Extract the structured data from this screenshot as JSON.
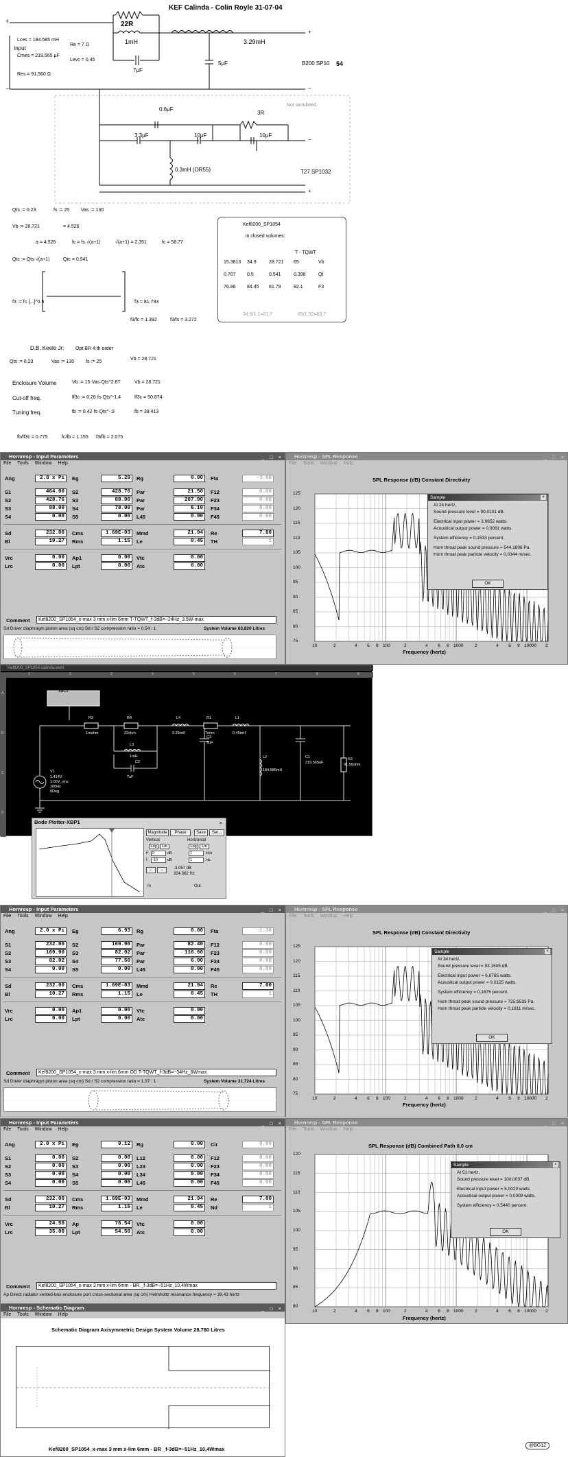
{
  "sketch": {
    "title": "KEF Calinda - Colin Royle 31-07-04",
    "lces": "Lces = 184.585 mH",
    "input": "Input",
    "cmes": "Cmes = 219.565 μF",
    "res": "Res = 91.560 Ω",
    "re": "Re = 7 Ω",
    "levc": "Levc = 0.45",
    "r22": "22R",
    "l1": "1mH",
    "c7": "7μF",
    "l329": "3.29mH",
    "c5": "5μF",
    "b200": "B200 SP10",
    "b200_num": "54",
    "notsim": "Not simulated.",
    "c06": "0.6μF",
    "r3": "3R",
    "c33": "3.3μF",
    "c10a": "10μF",
    "c10b": "10μF",
    "l03": "0.3mH (OR55)",
    "t27": "T27 SP1032",
    "plus": "+",
    "minus": "−",
    "l_qts": "Qts := 0.23",
    "l_fs": "fs := 25",
    "l_vas": "Vas := 130",
    "l_vb": "Vb := 28.721",
    "l_vb_res": "= 4.526",
    "l_a_res": "a = 4.526",
    "l_fc": "fc = fs·√(a+1)",
    "l_fc2": "√(a+1) = 2.351",
    "l_fc3": "fc = 58.77",
    "l_qtc": "Qtc := Qts·√(a+1)",
    "l_qtc2": "Qtc = 0.541",
    "l_f3": "f3 := fc·[...]^0.5",
    "l_f3r": "f3 = 81.793",
    "l_r1": "f3/fc = 1.392",
    "l_r2": "f3/fs = 3.272",
    "dbk": "D.B. Keele Jr:",
    "opt": "Opt BR 4:th order",
    "l2_qts": "Qts := 0.23",
    "l2_vas": "Vas := 130",
    "l2_fs": "fs := 25",
    "l2_vb": "Vb = 28.721",
    "ev": "Enclosure Volume",
    "ev_f": "Vb := 15·Vas·Qts^2.87",
    "ev_r": "Vb = 28.721",
    "cf": "Cut-off freq.",
    "cf_f": "ff3c := 0.26·fs·Qts^-1.4",
    "cf_r": "ff3c = 50.874",
    "tf": "Tuning freq.",
    "tf_f": "fb := 0.42·fs·Qts^-.9",
    "tf_r": "fb = 39.413",
    "last1": "fb/ff3c = 0.775",
    "last2": "fc/fb = 1.155",
    "last3": "f3/fb = 2.075",
    "box_title": "Kef8200_SP1054",
    "box_sub": "in closed volumes:",
    "box_ttq": "T - TQWT",
    "box_rows": [
      [
        "15.3813",
        "34.9",
        "28.721",
        "65",
        "Vb"
      ],
      [
        "0.707",
        "0.5",
        "0.541",
        "0.398",
        "Qt"
      ],
      [
        "76.86",
        "84.45",
        "81.79",
        "92.1",
        "F3"
      ]
    ],
    "box_n1": "34.9/1.1=31.7",
    "box_n2": "65/1.02=63.7"
  },
  "w1": {
    "title": "Hornresp - Input Parameters",
    "menu": [
      "File",
      "Tools",
      "Window",
      "Help"
    ],
    "rows": [
      [
        [
          "Ang",
          "2.0 x Pi"
        ],
        [
          "Eg",
          "5.29"
        ],
        [
          "Rg",
          "0.00"
        ],
        [
          "Fta",
          "-3.00"
        ]
      ],
      [
        [
          "S1",
          "464.00"
        ],
        [
          "S2",
          "428.76"
        ],
        [
          "Par",
          "21.50"
        ],
        [
          "F12",
          "0.00"
        ]
      ],
      [
        [
          "S2",
          "428.76"
        ],
        [
          "S3",
          "88.00"
        ],
        [
          "Par",
          "207.90"
        ],
        [
          "F23",
          "0.00"
        ]
      ],
      [
        [
          "S3",
          "88.00"
        ],
        [
          "S4",
          "78.00"
        ],
        [
          "Par",
          "6.10"
        ],
        [
          "F34",
          "0.00"
        ]
      ],
      [
        [
          "S4",
          "0.00"
        ],
        [
          "S5",
          "0.00"
        ],
        [
          "L45",
          "0.00"
        ],
        [
          "F45",
          "0.00"
        ]
      ],
      [
        [
          "Sd",
          "232.00"
        ],
        [
          "Cms",
          "1.69E-03"
        ],
        [
          "Mmd",
          "21.94"
        ],
        [
          "Re",
          "7.00"
        ]
      ],
      [
        [
          "Bl",
          "10.27"
        ],
        [
          "Rms",
          "1.15"
        ],
        [
          "Le",
          "0.45"
        ],
        [
          "TH",
          "1"
        ]
      ],
      [
        [
          "Vrc",
          "0.00"
        ],
        [
          "Ap1",
          "0.00"
        ],
        [
          "Vtc",
          "0.00"
        ],
        [
          "",
          ""
        ]
      ],
      [
        [
          "Lrc",
          "0.00"
        ],
        [
          "Lpt",
          "0.00"
        ],
        [
          "Atc",
          "0.00"
        ],
        [
          "",
          ""
        ]
      ]
    ],
    "comment_label": "Comment",
    "comment": "Kef8200_SP1054_x-max 3 mm x-lim 6mm T-TQWT_f-3dB=~24Hz_3.5W-max",
    "status_l": "Sd  Driver diaphragm piston area (sq cm)   Sd / S2 compression ratio = 0.54 : 1",
    "status_r": "System Volume 63,820 Litres"
  },
  "spl1": {
    "title": "Hornresp - SPL Response",
    "menu": [
      "File",
      "Tools",
      "Window",
      "Help"
    ],
    "header": "SPL Response (dB)   Constant Directivity",
    "xlabel": "Frequency (hertz)",
    "yticks": [
      "125",
      "120",
      "115",
      "110",
      "105",
      "100",
      "95",
      "90",
      "85",
      "80",
      "75"
    ],
    "xticks": [
      "10",
      "2",
      "4",
      "6",
      "8",
      "100",
      "2",
      "4",
      "6",
      "8",
      "1000",
      "2",
      "4",
      "6",
      "8",
      "10000",
      "2"
    ],
    "dlg_title": "Sample",
    "dlg_lines": [
      "At 24 hertz,",
      "Sound pressure level = 90,0101 dB.",
      "Electrical input power = 3,9652 watts.",
      "Acoustical output power = 0,0061 watts.",
      "System efficiency = 0,1533 percent.",
      "Horn throat peak sound pressure = 544,1806 Pa.",
      "Horn throat peak particle velocity = 0,0344 m/sec."
    ],
    "ok": "OK"
  },
  "schem": {
    "title": "Kef8200_SP1054-calinda.ewm",
    "xsc": "XSC1",
    "r3": "R3",
    "r3v": "1mohm",
    "r4": "R4",
    "r4v": "22ohm",
    "l4": "L4",
    "l4v": "3.29mH",
    "r1": "R1",
    "r1v": "7ohm",
    "l1": "L1",
    "l1v": "0.45mH",
    "l3": "L3",
    "l3v": "1mH",
    "c2": "C2",
    "c2v": "7uF",
    "c3": "C3",
    "c3v": "5uF",
    "l2": "L2",
    "l2v": "184.585mH",
    "c1": "C1",
    "c1v": "219.565uF",
    "r2": "R2",
    "r2v": "91.56ohm",
    "v1": "V1",
    "v1v": "1.414V",
    "v1b": "1.00V_rms",
    "v1c": "100Hz",
    "v1d": "0Deg",
    "cols": [
      "1",
      "2",
      "3",
      "4",
      "5",
      "6",
      "7",
      "8",
      "9"
    ],
    "rows": [
      "A",
      "B",
      "C",
      "D"
    ]
  },
  "bode": {
    "title": "Bode Plotter-XBP1",
    "mag": "Magnitude",
    "phase": "Phase",
    "save": "Save",
    "set": "Set...",
    "vertical": "Vertical",
    "horizontal": "Horizontal",
    "log": "Log",
    "lin": "Lin",
    "f1": "F",
    "f1v": "0",
    "f1u": "dB",
    "f2v": "1",
    "f2u": "kHz",
    "i1": "I",
    "i1v": "-10",
    "i1u": "dB",
    "i2v": "1",
    "i2u": "Hz",
    "read1": "-3.057 dB",
    "read2": "324.362 Hz",
    "in": "In",
    "out": "Out"
  },
  "w2": {
    "title": "Hornresp - Input Parameters",
    "menu": [
      "File",
      "Tools",
      "Window",
      "Help"
    ],
    "rows": [
      [
        [
          "Ang",
          "2.0 x Pi"
        ],
        [
          "Eg",
          "6.93"
        ],
        [
          "Rg",
          "0.00"
        ],
        [
          "Fta",
          "-1.30"
        ]
      ],
      [
        [
          "S1",
          "232.00"
        ],
        [
          "S2",
          "169.90"
        ],
        [
          "Par",
          "82.40"
        ],
        [
          "F12",
          "0.00"
        ]
      ],
      [
        [
          "S2",
          "169.90"
        ],
        [
          "S3",
          "82.02"
        ],
        [
          "Par",
          "116.60"
        ],
        [
          "F23",
          "0.00"
        ]
      ],
      [
        [
          "S3",
          "82.02"
        ],
        [
          "S4",
          "77.50"
        ],
        [
          "Par",
          "6.00"
        ],
        [
          "F34",
          "0.00"
        ]
      ],
      [
        [
          "S4",
          "0.00"
        ],
        [
          "S5",
          "0.00"
        ],
        [
          "L45",
          "0.00"
        ],
        [
          "F45",
          "0.00"
        ]
      ],
      [
        [
          "Sd",
          "232.00"
        ],
        [
          "Cms",
          "1.69E-03"
        ],
        [
          "Mmd",
          "21.94"
        ],
        [
          "Re",
          "7.00"
        ]
      ],
      [
        [
          "Bl",
          "10.27"
        ],
        [
          "Rms",
          "1.15"
        ],
        [
          "Le",
          "0.45"
        ],
        [
          "TH",
          "1"
        ]
      ],
      [
        [
          "Vrc",
          "0.00"
        ],
        [
          "Ap1",
          "0.00"
        ],
        [
          "Vtc",
          "0.00"
        ],
        [
          "",
          ""
        ]
      ],
      [
        [
          "Lrc",
          "0.00"
        ],
        [
          "Lpt",
          "0.00"
        ],
        [
          "Atc",
          "0.00"
        ],
        [
          "",
          ""
        ]
      ]
    ],
    "comment_label": "Comment",
    "comment": "Kef8200_SP1054_x-max 3 mm x-lim 6mm OD T-TQWT_f-3dB=~34Hz_6Wmax",
    "status_l": "Sd  Driver diaphragm piston area (sq cm)   Sd / S2 compression ratio = 1,37 : 1",
    "status_r": "System Volume 31,724 Litres"
  },
  "spl2": {
    "title": "Hornresp - SPL Response",
    "menu": [
      "File",
      "Tools",
      "Window",
      "Help"
    ],
    "header": "SPL Response (dB)   Constant Directivity",
    "xlabel": "Frequency (hertz)",
    "yticks": [
      "125",
      "120",
      "115",
      "110",
      "105",
      "100",
      "95",
      "90",
      "85",
      "80",
      "75"
    ],
    "xticks": [
      "10",
      "2",
      "4",
      "6",
      "8",
      "100",
      "2",
      "4",
      "6",
      "8",
      "1000",
      "2",
      "4",
      "6",
      "8",
      "10000",
      "2"
    ],
    "dlg_title": "Sample",
    "dlg_lines": [
      "At 34 hertz,",
      "Sound pressure level = 93,1505 dB.",
      "Electrical input power = 6,6785 watts.",
      "Acoustical output power = 0,0125 watts.",
      "System efficiency = 0,1875 percent.",
      "Horn throat peak sound pressure = 725,9533 Pa.",
      "Horn throat peak particle velocity = 0,1811 m/sec."
    ],
    "ok": "OK"
  },
  "w3": {
    "title": "Hornresp - Input Parameters",
    "menu": [
      "File",
      "Tools",
      "Window",
      "Help"
    ],
    "rows": [
      [
        [
          "Ang",
          "2.0 x Pi"
        ],
        [
          "Eg",
          "9.12"
        ],
        [
          "Rg",
          "0.00"
        ],
        [
          "Cir",
          "0.00"
        ]
      ],
      [
        [
          "S1",
          "0.00"
        ],
        [
          "S2",
          "0.00"
        ],
        [
          "L12",
          "0.00"
        ],
        [
          "F12",
          "0.00"
        ]
      ],
      [
        [
          "S2",
          "0.00"
        ],
        [
          "S3",
          "0.00"
        ],
        [
          "L23",
          "0.00"
        ],
        [
          "F23",
          "0.00"
        ]
      ],
      [
        [
          "S3",
          "0.00"
        ],
        [
          "S4",
          "0.00"
        ],
        [
          "L34",
          "0.00"
        ],
        [
          "F34",
          "0.00"
        ]
      ],
      [
        [
          "S4",
          "0.00"
        ],
        [
          "S5",
          "0.00"
        ],
        [
          "L45",
          "0.00"
        ],
        [
          "F45",
          "0.00"
        ]
      ],
      [
        [
          "Sd",
          "232.00"
        ],
        [
          "Cms",
          "1.69E-03"
        ],
        [
          "Mmd",
          "21.94"
        ],
        [
          "Re",
          "7.00"
        ]
      ],
      [
        [
          "Bl",
          "10.27"
        ],
        [
          "Rms",
          "1.15"
        ],
        [
          "Le",
          "0.45"
        ],
        [
          "Nd",
          "1"
        ]
      ],
      [
        [
          "Vrc",
          "24.50"
        ],
        [
          "Ap",
          "78.54"
        ],
        [
          "Vtc",
          "0.00"
        ],
        [
          "",
          ""
        ]
      ],
      [
        [
          "Lrc",
          "35.00"
        ],
        [
          "Lpt",
          "54.50"
        ],
        [
          "Atc",
          "0.00"
        ],
        [
          "",
          ""
        ]
      ]
    ],
    "comment_label": "Comment",
    "comment": "Kef8200_SP1054_x-max 3 mm x-lim 6mm  - BR  _f-3dB=~51Hz_10,4Wmax",
    "status_l": "Ap  Direct radiator vented-box enclosure port cross-sectional area (sq cm)   Helmholtz resonance frequency = 39,43 hertz"
  },
  "spl3": {
    "title": "Hornresp - SPL Response",
    "menu": [
      "File",
      "Tools",
      "Window",
      "Help"
    ],
    "header": "SPL Response (dB)   Combined   Path 0,0 cm",
    "xlabel": "Frequency (hertz)",
    "yticks": [
      "120",
      "115",
      "110",
      "105",
      "100",
      "95",
      "90",
      "85",
      "80"
    ],
    "xticks": [
      "10",
      "2",
      "4",
      "6",
      "8",
      "100",
      "2",
      "4",
      "6",
      "8",
      "1000",
      "2",
      "4",
      "6",
      "8",
      "10000",
      "2"
    ],
    "dlg_title": "Sample",
    "dlg_lines": [
      "At 51 hertz,",
      "Sound pressure level = 100,0037 dB.",
      "Electrical input power = 5,0029 watts.",
      "Acoustical output power = 0,0309 watts.",
      "System efficiency = 0,5440 percent."
    ],
    "ok": "OK"
  },
  "sd": {
    "title": "Hornresp - Schematic Diagram",
    "menu": [
      "File",
      "Tools",
      "Window",
      "Help"
    ],
    "header": "Schematic Diagram   Axisymmetric Design   System Volume 28,780 Litres",
    "footer": "Kef8200_SP1054_x-max 3 mm x-lim 6mm     -  BR   _f-3dB=~51Hz_10,4Wmax"
  },
  "badge": "@BG12"
}
